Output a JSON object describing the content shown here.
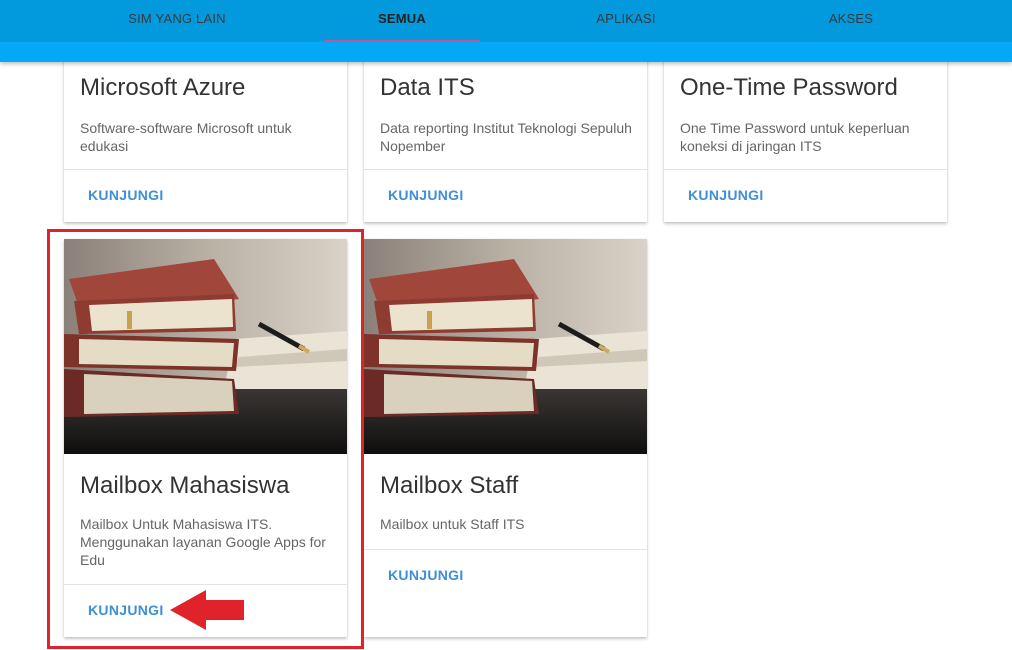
{
  "tabs": [
    {
      "label": "SIM YANG LAIN"
    },
    {
      "label": "SEMUA"
    },
    {
      "label": "APLIKASI"
    },
    {
      "label": "AKSES"
    }
  ],
  "active_tab": "SEMUA",
  "accent_colors": {
    "tab_bar": "#03a9f4",
    "tab_indicator": "#c2569b",
    "link": "#3d8fd6",
    "highlight": "#e0232b"
  },
  "cards": [
    {
      "title": "Microsoft Azure",
      "desc": "Software-software Microsoft untuk edukasi",
      "action": "KUNJUNGI"
    },
    {
      "title": "Data ITS",
      "desc": "Data reporting Institut Teknologi Sepuluh Nopember",
      "action": "KUNJUNGI"
    },
    {
      "title": "One-Time Password",
      "desc": "One Time Password untuk keperluan koneksi di jaringan ITS",
      "action": "KUNJUNGI"
    },
    {
      "title": "Mailbox Mahasiswa",
      "desc": "Mailbox Untuk Mahasiswa ITS. Menggunakan layanan Google Apps for Edu",
      "action": "KUNJUNGI"
    },
    {
      "title": "Mailbox Staff",
      "desc": "Mailbox untuk Staff ITS",
      "action": "KUNJUNGI"
    }
  ],
  "annotation": {
    "type": "red-box-and-arrow",
    "target": "Mailbox Mahasiswa KUNJUNGI"
  }
}
